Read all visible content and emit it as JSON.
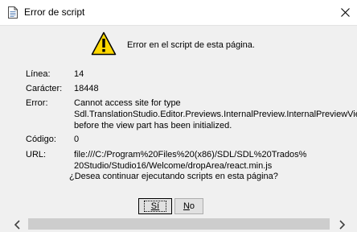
{
  "window": {
    "title": "Error de script"
  },
  "header": {
    "message": "Error en el script de esta página."
  },
  "details": {
    "line": {
      "label": "Línea:",
      "value": "14"
    },
    "char": {
      "label": "Carácter:",
      "value": "18448"
    },
    "error": {
      "label": "Error:",
      "value_line1": "Cannot access site for type",
      "value_line2": "Sdl.TranslationStudio.Editor.Previews.InternalPreview.InternalPreviewVie",
      "value_line3": "before the view part has been initialized."
    },
    "code": {
      "label": "Código:",
      "value": "0"
    },
    "url": {
      "label": "URL:",
      "value_line1": "file:///C:/Program%20Files%20(x86)/SDL/SDL%20Trados%",
      "value_line2": "20Studio/Studio16/Welcome/dropArea/react.min.js"
    }
  },
  "question": "¿Desea continuar ejecutando scripts en esta página?",
  "buttons": {
    "yes": {
      "underlined": "S",
      "rest": "í"
    },
    "no": {
      "underlined": "N",
      "rest": "o"
    }
  },
  "icons": {
    "title": "document-icon",
    "warning": "warning-icon",
    "close": "close-icon",
    "scroll_left": "chevron-left-icon",
    "scroll_right": "chevron-right-icon"
  },
  "colors": {
    "warning_fill": "#ffd800",
    "warning_stroke": "#000000",
    "client_bg": "#f0f0f0"
  }
}
